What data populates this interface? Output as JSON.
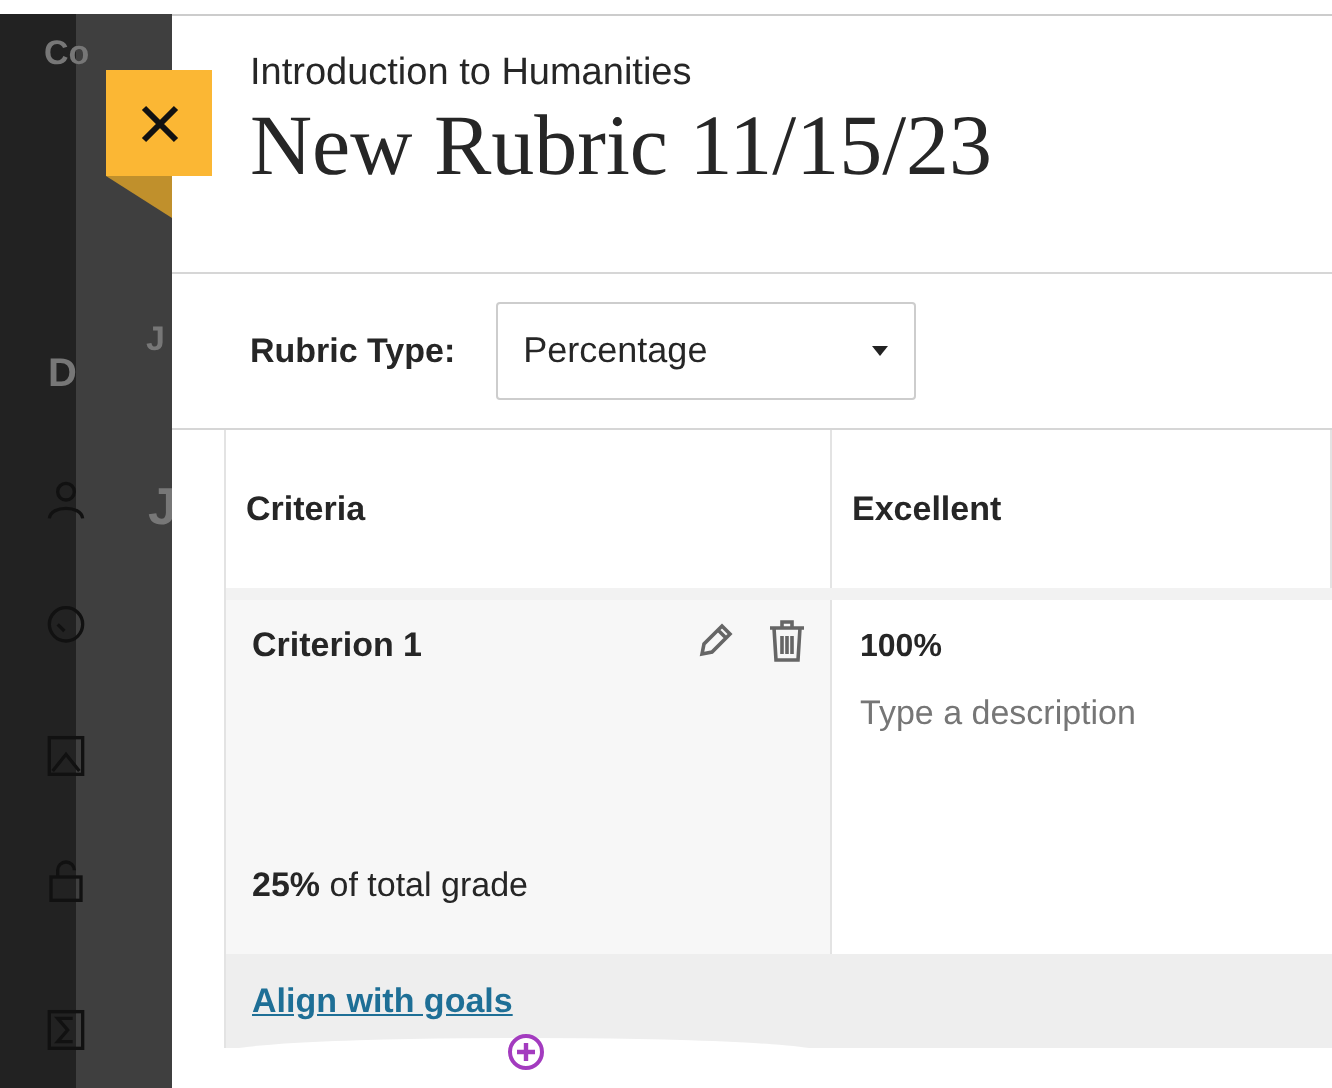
{
  "background": {
    "course_title": "Co",
    "nav_heading": "D",
    "tab": "J",
    "page_heading": "J"
  },
  "drawer": {
    "course": "Introduction to Humanities",
    "title": "New Rubric 11/15/23",
    "rubric_type": {
      "label": "Rubric Type:",
      "value": "Percentage"
    },
    "columns": [
      "Criteria",
      "Excellent"
    ],
    "criteria": [
      {
        "name": "Criterion 1",
        "weight": "**25%** of total grade",
        "link": "Align with goals",
        "cells": [
          {
            "value": "100%",
            "placeholder": "Type a description"
          }
        ]
      }
    ]
  }
}
